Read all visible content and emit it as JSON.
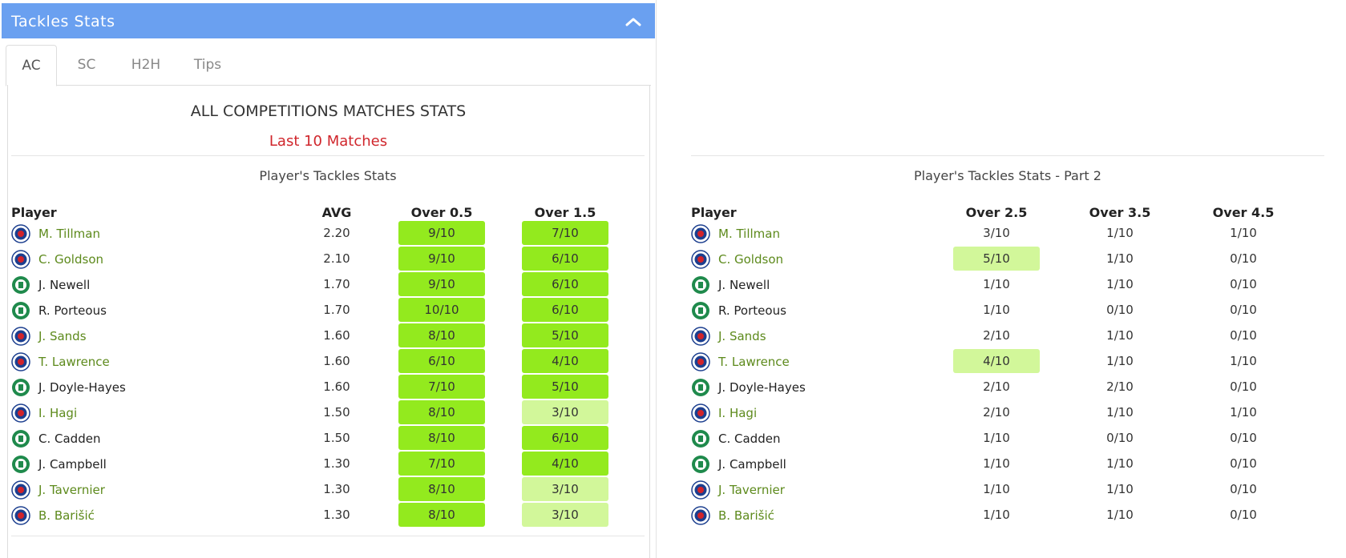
{
  "header": {
    "title": "Tackles Stats"
  },
  "tabs": [
    {
      "id": "ac",
      "label": "AC",
      "active": true
    },
    {
      "id": "sc",
      "label": "SC",
      "active": false
    },
    {
      "id": "h2h",
      "label": "H2H",
      "active": false
    },
    {
      "id": "tips",
      "label": "Tips",
      "active": false
    }
  ],
  "section": {
    "title": "ALL COMPETITIONS MATCHES STATS",
    "subtitle": "Last 10 Matches"
  },
  "colors": {
    "header": "#6aa0f0",
    "strong": "#93ea1e",
    "light": "#d2f79a",
    "rangers_name": "#5d8a1c",
    "subtitle": "#d0262c"
  },
  "table1": {
    "caption": "Player's Tackles Stats",
    "headers": [
      "Player",
      "AVG",
      "Over 0.5",
      "Over 1.5"
    ]
  },
  "table2": {
    "caption": "Player's Tackles Stats - Part 2",
    "headers": [
      "Player",
      "Over 2.5",
      "Over 3.5",
      "Over 4.5"
    ]
  },
  "players": [
    {
      "name": "M. Tillman",
      "team": "rangers",
      "badge": "rangers-badge-icon",
      "avg": "2.20",
      "o05": "9/10",
      "o15": "7/10",
      "o25": "3/10",
      "o35": "1/10",
      "o45": "1/10",
      "hl": [
        "strong",
        "strong",
        "none",
        "none",
        "none"
      ]
    },
    {
      "name": "C. Goldson",
      "team": "rangers",
      "badge": "rangers-badge-icon",
      "avg": "2.10",
      "o05": "9/10",
      "o15": "6/10",
      "o25": "5/10",
      "o35": "1/10",
      "o45": "0/10",
      "hl": [
        "strong",
        "strong",
        "light",
        "none",
        "none"
      ]
    },
    {
      "name": "J. Newell",
      "team": "hibs",
      "badge": "hibernian-badge-icon",
      "avg": "1.70",
      "o05": "9/10",
      "o15": "6/10",
      "o25": "1/10",
      "o35": "1/10",
      "o45": "0/10",
      "hl": [
        "strong",
        "strong",
        "none",
        "none",
        "none"
      ]
    },
    {
      "name": "R. Porteous",
      "team": "hibs",
      "badge": "hibernian-badge-icon",
      "avg": "1.70",
      "o05": "10/10",
      "o15": "6/10",
      "o25": "1/10",
      "o35": "0/10",
      "o45": "0/10",
      "hl": [
        "strong",
        "strong",
        "none",
        "none",
        "none"
      ]
    },
    {
      "name": "J. Sands",
      "team": "rangers",
      "badge": "rangers-badge-icon",
      "avg": "1.60",
      "o05": "8/10",
      "o15": "5/10",
      "o25": "2/10",
      "o35": "1/10",
      "o45": "0/10",
      "hl": [
        "strong",
        "strong",
        "none",
        "none",
        "none"
      ]
    },
    {
      "name": "T. Lawrence",
      "team": "rangers",
      "badge": "rangers-badge-icon",
      "avg": "1.60",
      "o05": "6/10",
      "o15": "4/10",
      "o25": "4/10",
      "o35": "1/10",
      "o45": "1/10",
      "hl": [
        "strong",
        "strong",
        "light",
        "none",
        "none"
      ]
    },
    {
      "name": "J. Doyle-Hayes",
      "team": "hibs",
      "badge": "hibernian-badge-icon",
      "avg": "1.60",
      "o05": "7/10",
      "o15": "5/10",
      "o25": "2/10",
      "o35": "2/10",
      "o45": "0/10",
      "hl": [
        "strong",
        "strong",
        "none",
        "none",
        "none"
      ]
    },
    {
      "name": "I. Hagi",
      "team": "rangers",
      "badge": "rangers-badge-icon",
      "avg": "1.50",
      "o05": "8/10",
      "o15": "3/10",
      "o25": "2/10",
      "o35": "1/10",
      "o45": "1/10",
      "hl": [
        "strong",
        "light",
        "none",
        "none",
        "none"
      ]
    },
    {
      "name": "C. Cadden",
      "team": "hibs",
      "badge": "hibernian-badge-icon",
      "avg": "1.50",
      "o05": "8/10",
      "o15": "6/10",
      "o25": "1/10",
      "o35": "0/10",
      "o45": "0/10",
      "hl": [
        "strong",
        "strong",
        "none",
        "none",
        "none"
      ]
    },
    {
      "name": "J. Campbell",
      "team": "hibs",
      "badge": "hibernian-badge-icon",
      "avg": "1.30",
      "o05": "7/10",
      "o15": "4/10",
      "o25": "1/10",
      "o35": "1/10",
      "o45": "0/10",
      "hl": [
        "strong",
        "strong",
        "none",
        "none",
        "none"
      ]
    },
    {
      "name": "J. Tavernier",
      "team": "rangers",
      "badge": "rangers-badge-icon",
      "avg": "1.30",
      "o05": "8/10",
      "o15": "3/10",
      "o25": "1/10",
      "o35": "1/10",
      "o45": "0/10",
      "hl": [
        "strong",
        "light",
        "none",
        "none",
        "none"
      ]
    },
    {
      "name": "B. Barišić",
      "team": "rangers",
      "badge": "rangers-badge-icon",
      "avg": "1.30",
      "o05": "8/10",
      "o15": "3/10",
      "o25": "1/10",
      "o35": "1/10",
      "o45": "0/10",
      "hl": [
        "strong",
        "light",
        "none",
        "none",
        "none"
      ]
    }
  ]
}
